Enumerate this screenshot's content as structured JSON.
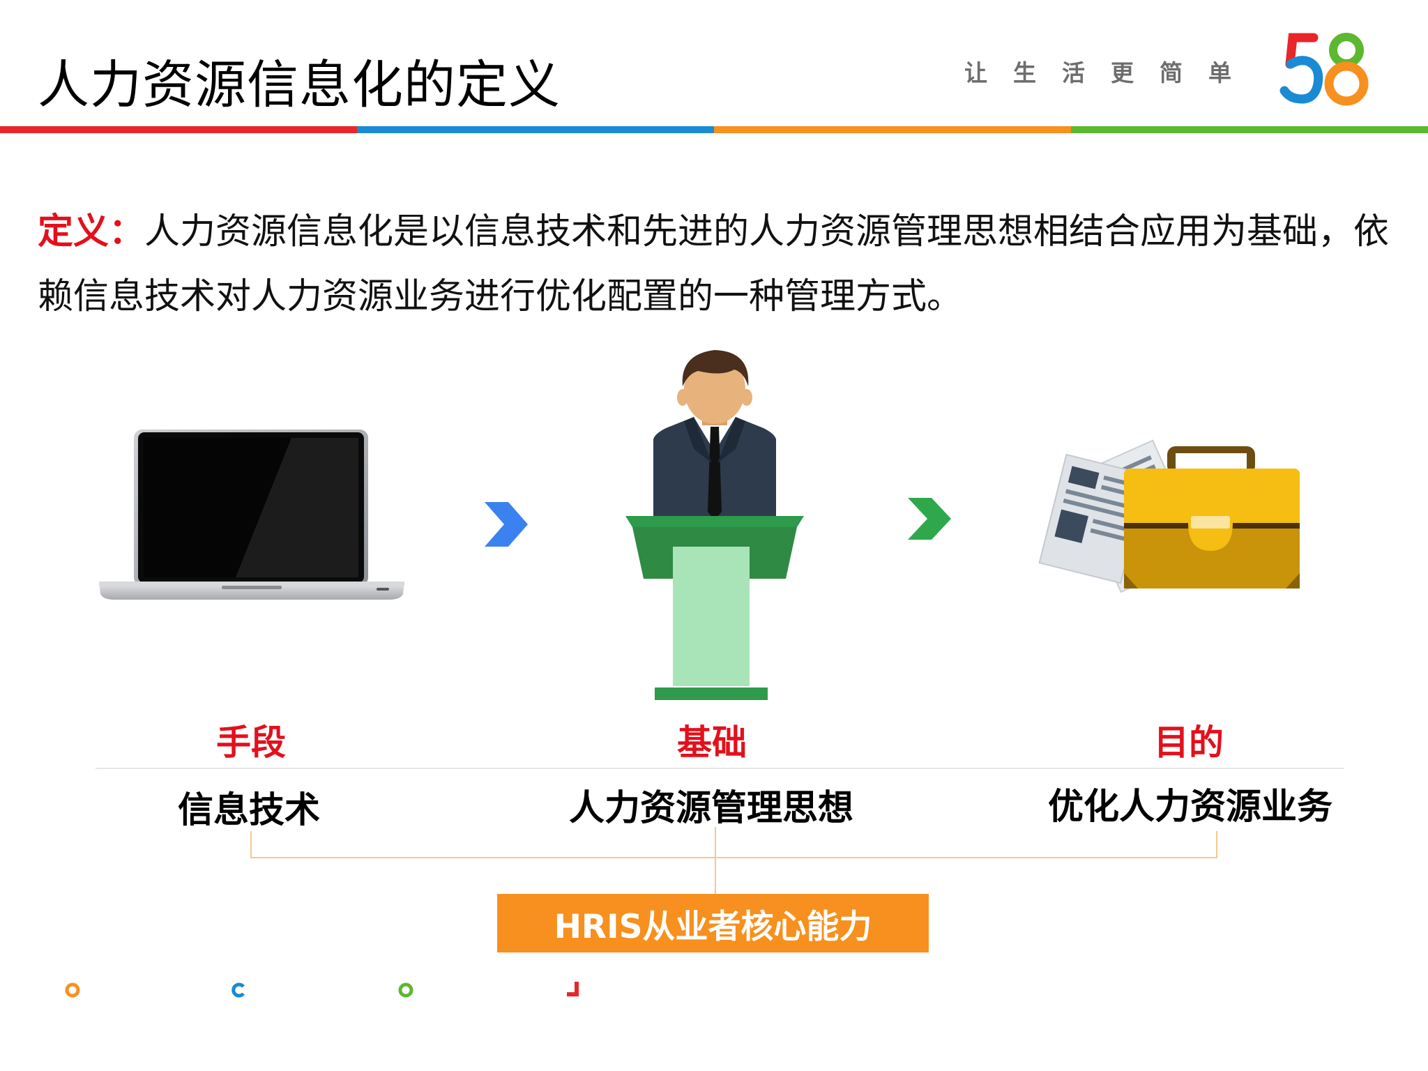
{
  "header": {
    "title": "人力资源信息化的定义",
    "slogan": "让生活更简单",
    "logo_text": "58",
    "bar_colors": [
      "#e8262a",
      "#1a8ad4",
      "#f7901e",
      "#5cb82e"
    ]
  },
  "definition": {
    "label": "定义：",
    "text": "人力资源信息化是以信息技术和先进的人力资源管理思想相结合应用为基础，依赖信息技术对人力资源业务进行优化配置的一种管理方式。"
  },
  "columns": [
    {
      "label": "手段",
      "value": "信息技术",
      "icon": "laptop-icon"
    },
    {
      "label": "基础",
      "value": "人力资源管理思想",
      "icon": "speaker-at-podium-icon"
    },
    {
      "label": "目的",
      "value": "优化人力资源业务",
      "icon": "briefcase-with-documents-icon"
    }
  ],
  "arrows": [
    {
      "icon": "chevron-right-icon",
      "color": "#3b82f0"
    },
    {
      "icon": "chevron-right-icon",
      "color": "#2ea84a"
    }
  ],
  "summary": {
    "label": "HRIS从业者核心能力",
    "color": "#f7901e"
  },
  "decor_dots": [
    {
      "icon": "circle-icon",
      "color": "#f7901e"
    },
    {
      "icon": "arc-c-icon",
      "color": "#1a8ad4"
    },
    {
      "icon": "circle-icon",
      "color": "#5cb82e"
    },
    {
      "icon": "corner-icon",
      "color": "#e8262a"
    }
  ]
}
